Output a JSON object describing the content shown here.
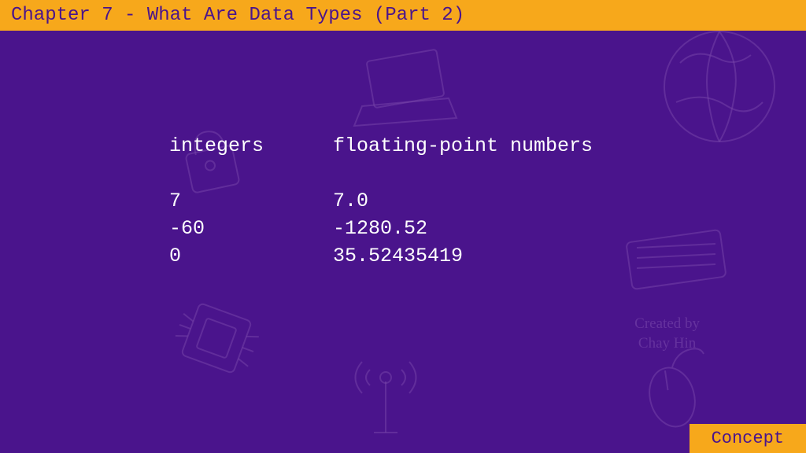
{
  "header": {
    "title": "Chapter 7 - What Are Data Types (Part 2)"
  },
  "content": {
    "integers": {
      "header": "integers",
      "values": [
        "7",
        "-60",
        "0"
      ]
    },
    "floats": {
      "header": "floating-point numbers",
      "values": [
        "7.0",
        "-1280.52",
        "35.52435419"
      ]
    }
  },
  "credit": {
    "line1": "Created by",
    "line2": "Chay Hin"
  },
  "footer": {
    "label": "Concept"
  }
}
